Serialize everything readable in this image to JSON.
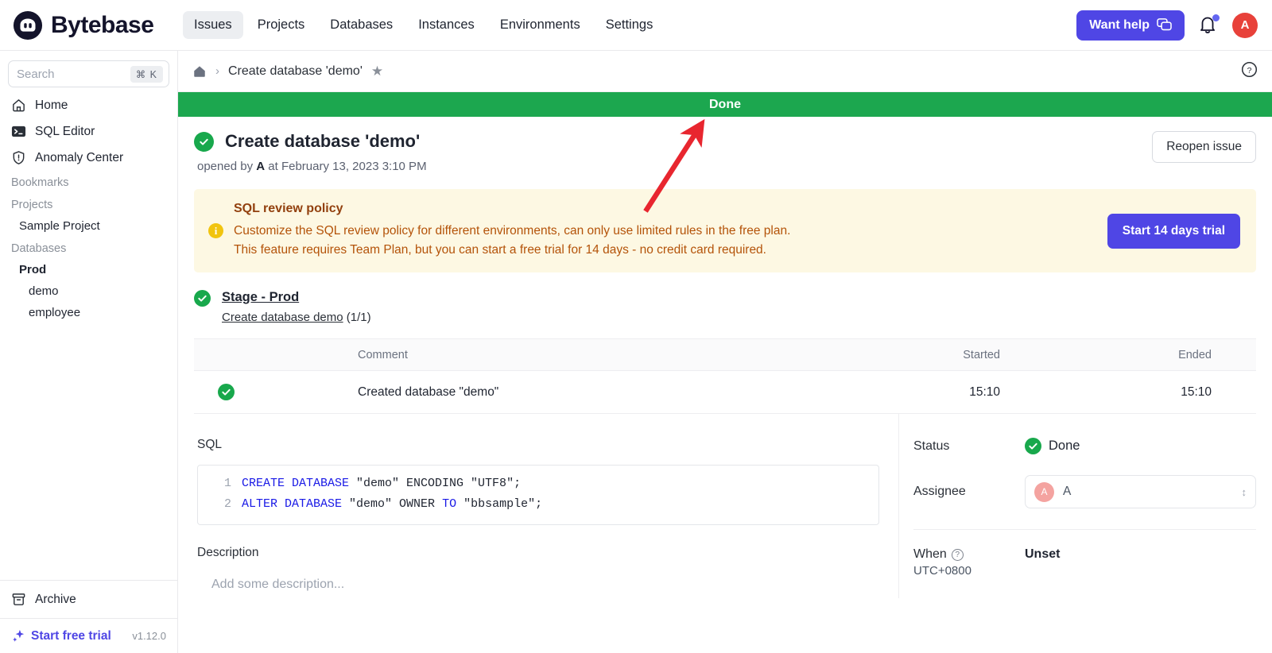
{
  "header": {
    "brand": "Bytebase",
    "nav": [
      {
        "label": "Issues",
        "active": true
      },
      {
        "label": "Projects",
        "active": false
      },
      {
        "label": "Databases",
        "active": false
      },
      {
        "label": "Instances",
        "active": false
      },
      {
        "label": "Environments",
        "active": false
      },
      {
        "label": "Settings",
        "active": false
      }
    ],
    "help_button": "Want help",
    "avatar_initial": "A"
  },
  "sidebar": {
    "search_placeholder": "Search",
    "search_shortcut": "⌘ K",
    "links": [
      {
        "label": "Home",
        "icon": "home-icon"
      },
      {
        "label": "SQL Editor",
        "icon": "terminal-icon"
      },
      {
        "label": "Anomaly Center",
        "icon": "shield-icon"
      }
    ],
    "bookmarks_label": "Bookmarks",
    "projects_label": "Projects",
    "projects": [
      "Sample Project"
    ],
    "databases_label": "Databases",
    "database_group": "Prod",
    "databases": [
      "demo",
      "employee"
    ],
    "archive_label": "Archive",
    "trial_label": "Start free trial",
    "version": "v1.12.0"
  },
  "breadcrumb": {
    "home_icon": "home-icon",
    "separator": "›",
    "current": "Create database 'demo'",
    "star_icon": "star-icon",
    "help_icon": "question-circle-icon"
  },
  "banner": {
    "text": "Done",
    "color": "#1ca74f"
  },
  "issue": {
    "title": "Create database 'demo'",
    "opened_prefix": "opened by",
    "opened_user": "A",
    "opened_middle": "at",
    "opened_time": "February 13, 2023 3:10 PM",
    "reopen_button": "Reopen issue"
  },
  "notice": {
    "title": "SQL review policy",
    "line1": "Customize the SQL review policy for different environments, can only use limited rules in the free plan.",
    "line2": "This feature requires Team Plan, but you can start a free trial for 14 days - no credit card required.",
    "action": "Start 14 days trial"
  },
  "stage": {
    "name": "Stage - Prod",
    "task": "Create database demo",
    "count": "(1/1)"
  },
  "task_table": {
    "columns": [
      "",
      "Comment",
      "Started",
      "Ended"
    ],
    "rows": [
      {
        "status": "done",
        "comment": "Created database \"demo\"",
        "started": "15:10",
        "ended": "15:10"
      }
    ]
  },
  "sql_panel": {
    "label": "SQL",
    "lines": [
      {
        "num": "1",
        "kw1": "CREATE DATABASE",
        "rest": " \"demo\" ENCODING \"UTF8\";"
      },
      {
        "num": "2",
        "kw1": "ALTER DATABASE",
        "rest": " \"demo\" OWNER ",
        "kw2": "TO",
        "rest2": " \"bbsample\";"
      }
    ]
  },
  "description": {
    "label": "Description",
    "placeholder": "Add some description..."
  },
  "details": {
    "status_label": "Status",
    "status_value": "Done",
    "assignee_label": "Assignee",
    "assignee_initial": "A",
    "assignee_name": "A",
    "when_label": "When",
    "when_tz": "UTC+0800",
    "when_value": "Unset"
  },
  "annotation": {
    "arrow_color": "#e8262f"
  }
}
